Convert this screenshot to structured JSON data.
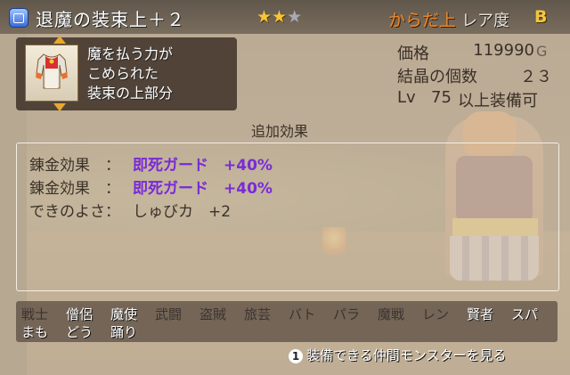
{
  "item": {
    "name": "退魔の装束上＋２",
    "stars": "★★",
    "stars_empty": "★",
    "slot": "からだ上",
    "rarity_label": "レア度",
    "rarity_value": "B",
    "icon": "equipment-bag-icon",
    "thumbnail": "shirt-icon",
    "description": [
      "魔を払う力が",
      "こめられた",
      "装束の上部分"
    ]
  },
  "stats": {
    "price_label": "価格",
    "price_value": "119990",
    "price_unit": "G",
    "crystals_label": "結晶の個数",
    "crystals_value": "２３",
    "level_prefix": "Lv",
    "level_value": "75",
    "level_suffix": "以上装備可"
  },
  "effects": {
    "title": "追加効果",
    "rows": [
      {
        "label": "錬金効果　：",
        "value": "即死ガード　+40%"
      },
      {
        "label": "錬金効果　：",
        "value": "即死ガード　+40%"
      },
      {
        "label": "できのよさ：",
        "value": "しゅびカ　+2"
      }
    ]
  },
  "jobs": {
    "row1": [
      {
        "label": "戦士",
        "equippable": false
      },
      {
        "label": "僧侶",
        "equippable": true
      },
      {
        "label": "魔使",
        "equippable": true
      },
      {
        "label": "武闘",
        "equippable": false
      },
      {
        "label": "盗賊",
        "equippable": false
      },
      {
        "label": "旅芸",
        "equippable": false
      },
      {
        "label": "バト",
        "equippable": false
      },
      {
        "label": "パラ",
        "equippable": false
      },
      {
        "label": "魔戦",
        "equippable": false
      },
      {
        "label": "レン",
        "equippable": false
      },
      {
        "label": "賢者",
        "equippable": true
      },
      {
        "label": "スパ",
        "equippable": true
      }
    ],
    "row2": [
      {
        "label": "まも",
        "equippable": true
      },
      {
        "label": "どう",
        "equippable": true
      },
      {
        "label": "踊り",
        "equippable": true
      }
    ]
  },
  "footer": {
    "button": "1",
    "label": "装備できる仲間モンスターを見る"
  },
  "colors": {
    "gold": "#f5c63a",
    "slot_orange": "#f08a2a",
    "effect_purple": "#7a2ad8"
  }
}
